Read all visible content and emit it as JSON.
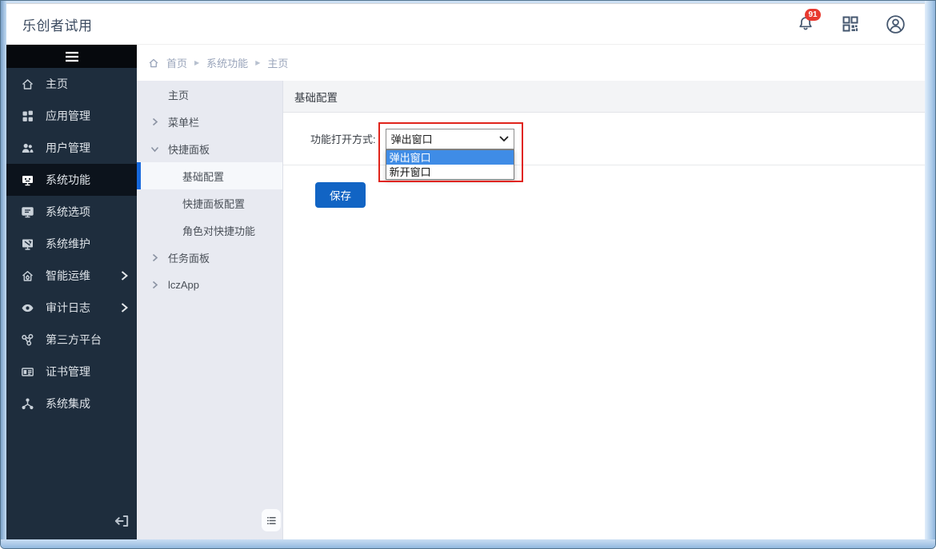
{
  "header": {
    "title": "乐创者试用",
    "notification_badge": "91"
  },
  "sidebar": {
    "items": [
      {
        "label": "主页",
        "icon": "home-icon",
        "selected": false,
        "expandable": false
      },
      {
        "label": "应用管理",
        "icon": "apps-icon",
        "selected": false,
        "expandable": false
      },
      {
        "label": "用户管理",
        "icon": "users-icon",
        "selected": false,
        "expandable": false
      },
      {
        "label": "系统功能",
        "icon": "system-icon",
        "selected": true,
        "expandable": false
      },
      {
        "label": "系统选项",
        "icon": "monitor-icon",
        "selected": false,
        "expandable": false
      },
      {
        "label": "系统维护",
        "icon": "maintenance-icon",
        "selected": false,
        "expandable": false
      },
      {
        "label": "智能运维",
        "icon": "smart-ops-icon",
        "selected": false,
        "expandable": true
      },
      {
        "label": "审计日志",
        "icon": "eye-icon",
        "selected": false,
        "expandable": true
      },
      {
        "label": "第三方平台",
        "icon": "share-icon",
        "selected": false,
        "expandable": false
      },
      {
        "label": "证书管理",
        "icon": "certificate-icon",
        "selected": false,
        "expandable": false
      },
      {
        "label": "系统集成",
        "icon": "integration-icon",
        "selected": false,
        "expandable": false
      }
    ]
  },
  "breadcrumb": {
    "items": [
      "首页",
      "系统功能",
      "主页"
    ]
  },
  "submenu": {
    "items": [
      {
        "label": "主页",
        "chevron": "none",
        "child": false,
        "selected": false
      },
      {
        "label": "菜单栏",
        "chevron": "right",
        "child": false,
        "selected": false
      },
      {
        "label": "快捷面板",
        "chevron": "down",
        "child": false,
        "selected": false
      },
      {
        "label": "基础配置",
        "chevron": "none",
        "child": true,
        "selected": true
      },
      {
        "label": "快捷面板配置",
        "chevron": "none",
        "child": true,
        "selected": false
      },
      {
        "label": "角色对快捷功能",
        "chevron": "none",
        "child": true,
        "selected": false
      },
      {
        "label": "任务面板",
        "chevron": "right",
        "child": false,
        "selected": false
      },
      {
        "label": "lczApp",
        "chevron": "right",
        "child": false,
        "selected": false
      }
    ]
  },
  "main": {
    "page_title": "基础配置",
    "form": {
      "label": "功能打开方式:",
      "select_value": "弹出窗口",
      "options": [
        {
          "label": "弹出窗口",
          "highlighted": true
        },
        {
          "label": "新开窗口",
          "highlighted": false
        }
      ]
    },
    "save_label": "保存"
  },
  "colors": {
    "accent_blue": "#1164c4",
    "option_highlight": "#3f8ce6",
    "annotation_red": "#e0241b",
    "badge_red": "#e83a30",
    "sidebar_bg": "#1e2d3d",
    "sidebar_selected_bg": "#0c131c",
    "submenu_bg": "#e8eaf1",
    "submenu_selected_border": "#1668dc"
  }
}
